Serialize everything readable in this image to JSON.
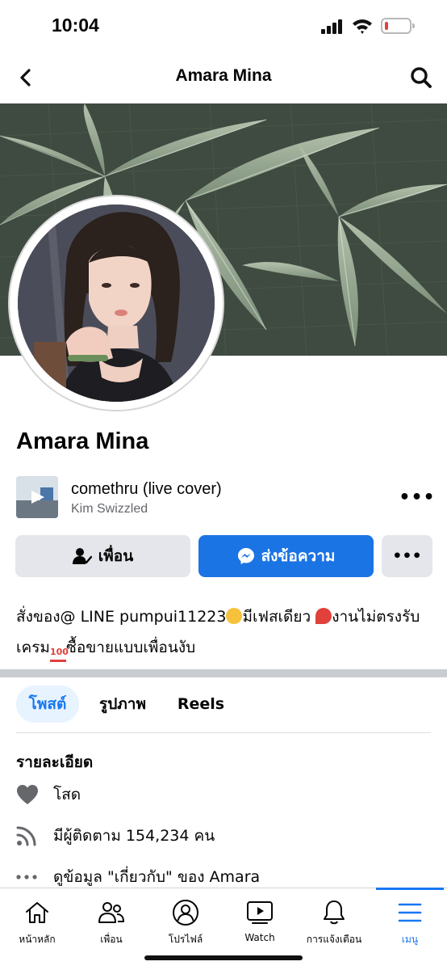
{
  "status_bar": {
    "time": "10:04"
  },
  "nav": {
    "title": "Amara Mina",
    "back_icon": "chevron-left-icon",
    "search_icon": "search-icon"
  },
  "profile": {
    "name": "Amara Mina",
    "music": {
      "title": "comethru (live cover)",
      "artist": "Kim Swizzled",
      "more_label": "•••"
    },
    "buttons": {
      "friend_label": "เพื่อน",
      "message_label": "ส่งข้อความ",
      "more_label": "•••"
    },
    "bio": {
      "part1": "สั่งของ@ LINE pumpui11223",
      "part2": "มีเฟสเดียว",
      "part3": "งานไม่ตรงรับเครม",
      "part4": "ซื้อขายแบบเพื่อนงับ"
    }
  },
  "tabs": [
    {
      "label": "โพสต์",
      "active": true
    },
    {
      "label": "รูปภาพ",
      "active": false
    },
    {
      "label": "Reels",
      "active": false
    }
  ],
  "details": {
    "heading": "รายละเอียด",
    "items": [
      {
        "icon": "heart-icon",
        "text": "โสด"
      },
      {
        "icon": "rss-icon",
        "text": "มีผู้ติดตาม 154,234 คน"
      },
      {
        "icon": "more-dots-icon",
        "text": "ดูข้อมูล \"เกี่ยวกับ\" ของ Amara"
      }
    ]
  },
  "tabbar": [
    {
      "label": "หน้าหลัก",
      "icon": "home-icon",
      "active": false
    },
    {
      "label": "เพื่อน",
      "icon": "friends-icon",
      "active": false
    },
    {
      "label": "โปรไฟล์",
      "icon": "profile-icon",
      "active": false
    },
    {
      "label": "Watch",
      "icon": "watch-icon",
      "active": false
    },
    {
      "label": "การแจ้งเตือน",
      "icon": "bell-icon",
      "active": false
    },
    {
      "label": "เมนู",
      "icon": "menu-icon",
      "active": true
    }
  ],
  "colors": {
    "accent": "#1877f2",
    "message_button": "#1b74e4",
    "button_gray": "#e4e6eb",
    "muted_text": "#65676b"
  }
}
